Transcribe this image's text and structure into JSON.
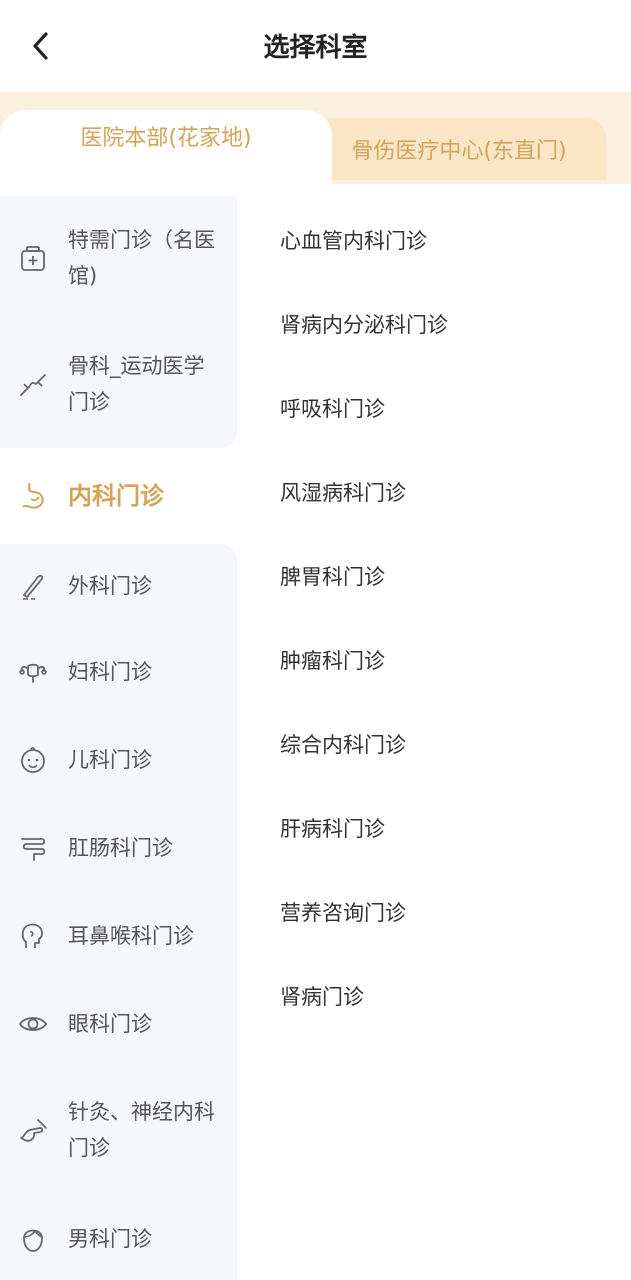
{
  "header": {
    "title": "选择科室",
    "back_icon": "chevron-left-icon"
  },
  "tabs": [
    {
      "label": "医院本部(花家地)",
      "active": true
    },
    {
      "label": "骨伤医疗中心(东直门)",
      "active": false
    }
  ],
  "colors": {
    "accent": "#d3a35a",
    "tab_bar_bg": "#fbf0df",
    "inactive_tab_bg": "#fae6c6",
    "sidebar_bg": "#f6f7fb"
  },
  "sidebar": {
    "items": [
      {
        "label": "特需门诊（名医馆)",
        "icon": "medical-kit-icon",
        "active": false
      },
      {
        "label": "骨科_运动医学门诊",
        "icon": "bone-joint-icon",
        "active": false
      },
      {
        "label": "内科门诊",
        "icon": "stomach-icon",
        "active": true
      },
      {
        "label": "外科门诊",
        "icon": "scalpel-icon",
        "active": false
      },
      {
        "label": "妇科门诊",
        "icon": "uterus-icon",
        "active": false
      },
      {
        "label": "儿科门诊",
        "icon": "baby-face-icon",
        "active": false
      },
      {
        "label": "肛肠科门诊",
        "icon": "intestine-icon",
        "active": false
      },
      {
        "label": "耳鼻喉科门诊",
        "icon": "ear-nose-throat-icon",
        "active": false
      },
      {
        "label": "眼科门诊",
        "icon": "eye-icon",
        "active": false
      },
      {
        "label": "针灸、神经内科门诊",
        "icon": "acupuncture-hand-icon",
        "active": false
      },
      {
        "label": "男科门诊",
        "icon": "male-head-icon",
        "active": false
      }
    ]
  },
  "departments": [
    "心血管内科门诊",
    "肾病内分泌科门诊",
    "呼吸科门诊",
    "风湿病科门诊",
    "脾胃科门诊",
    "肿瘤科门诊",
    "综合内科门诊",
    "肝病科门诊",
    "营养咨询门诊",
    "肾病门诊"
  ]
}
